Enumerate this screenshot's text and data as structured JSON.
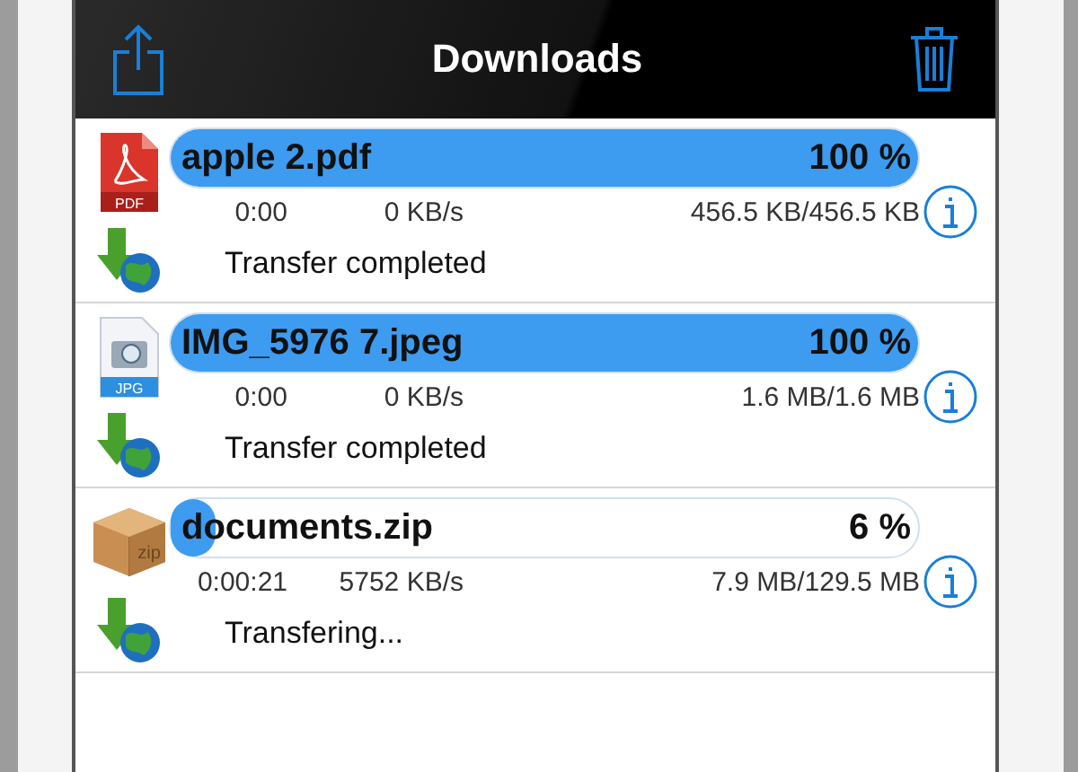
{
  "title": "Downloads",
  "downloads": [
    {
      "kind": "pdf",
      "badge": "PDF",
      "name": "apple 2.pdf",
      "level": 1,
      "percent": "100 %",
      "time": "0:00",
      "speed": "0 KB/s",
      "size": "456.5 KB/456.5 KB",
      "status": "Transfer completed"
    },
    {
      "kind": "jpg",
      "badge": "JPG",
      "name": "IMG_5976 7.jpeg",
      "level": 1,
      "percent": "100 %",
      "time": "0:00",
      "speed": "0 KB/s",
      "size": "1.6 MB/1.6 MB",
      "status": "Transfer completed"
    },
    {
      "kind": "zip",
      "badge": "zip",
      "name": "documents.zip",
      "level": 0.06,
      "percent": "6 %",
      "time": "0:00:21",
      "speed": "5752 KB/s",
      "size": "7.9 MB/129.5 MB",
      "status": "Transfering..."
    }
  ]
}
